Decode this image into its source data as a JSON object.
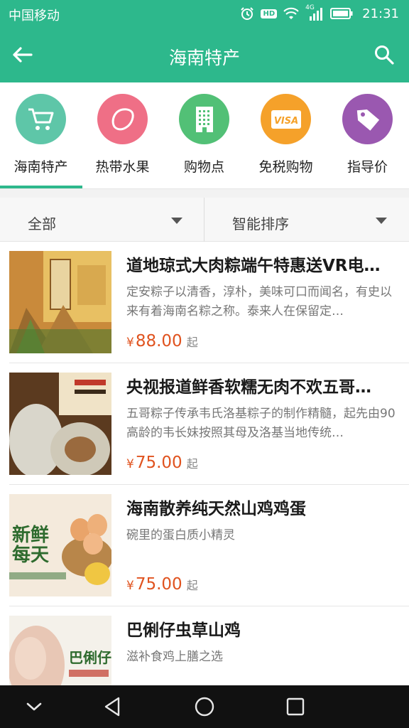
{
  "status_bar": {
    "carrier": "中国移动",
    "hd": "HD",
    "network": "4G",
    "time": "21:31"
  },
  "header": {
    "title": "海南特产",
    "back_icon": "arrow-left-icon",
    "search_icon": "search-icon",
    "color": "#2db88c"
  },
  "categories": [
    {
      "label": "海南特产",
      "icon": "cart-icon",
      "color": "#5ec6a8",
      "selected": true
    },
    {
      "label": "热带水果",
      "icon": "lemon-icon",
      "color": "#ef6f86",
      "selected": false
    },
    {
      "label": "购物点",
      "icon": "building-icon",
      "color": "#52c076",
      "selected": false
    },
    {
      "label": "免税购物",
      "icon": "visa-card-icon",
      "color": "#f5a12a",
      "selected": false
    },
    {
      "label": "指导价",
      "icon": "price-tag-icon",
      "color": "#9a58b0",
      "selected": false
    }
  ],
  "filters": {
    "category": "全部",
    "sort": "智能排序"
  },
  "products": [
    {
      "name": "道地琼式大肉粽端午特惠送VR电…",
      "desc": "定安粽子以清香，淳朴，美味可口而闻名，有史以来有着海南名粽之称。泰来人在保留定…",
      "currency": "¥",
      "price": "88.00",
      "suffix": "起"
    },
    {
      "name": "央视报道鲜香软糯无肉不欢五哥…",
      "desc": "五哥粽子传承韦氏洛基粽子的制作精髓，起先由90高龄的韦长妹按照其母及洛基当地传统…",
      "currency": "¥",
      "price": "75.00",
      "suffix": "起"
    },
    {
      "name": "海南散养纯天然山鸡鸡蛋",
      "desc": "碗里的蛋白质小精灵",
      "currency": "¥",
      "price": "75.00",
      "suffix": "起"
    },
    {
      "name": "巴俐仔虫草山鸡",
      "desc": "滋补食鸡上膳之选",
      "currency": "¥",
      "price": "",
      "suffix": ""
    }
  ],
  "nav": {
    "hide_icon": "chevron-down-icon",
    "back_icon": "triangle-back-icon",
    "home_icon": "circle-home-icon",
    "recent_icon": "square-recent-icon"
  }
}
